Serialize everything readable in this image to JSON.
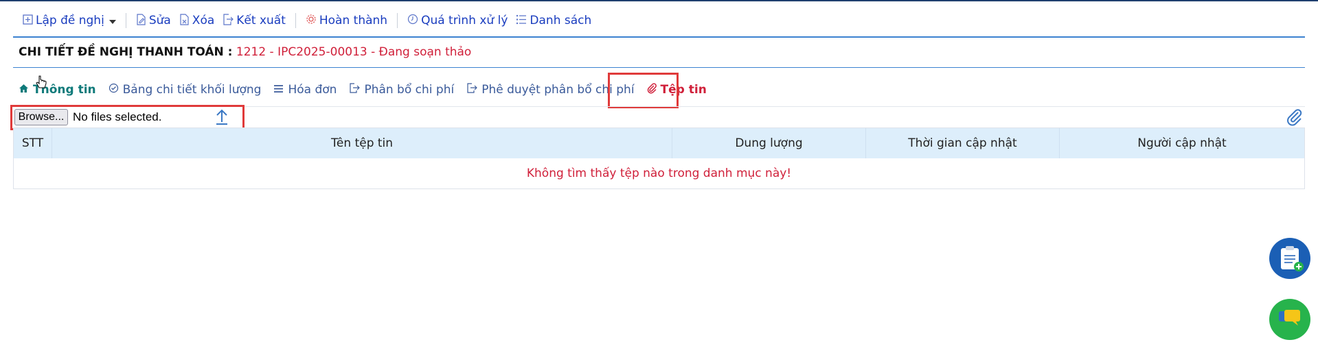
{
  "toolbar": {
    "create": "Lập đề nghị",
    "edit": "Sửa",
    "delete": "Xóa",
    "export": "Kết xuất",
    "complete": "Hoàn thành",
    "process": "Quá trình xử lý",
    "list": "Danh sách"
  },
  "header": {
    "label": "CHI TIẾT ĐỀ NGHỊ THANH TOÁN :",
    "value": "1212 - IPC2025-00013 - Đang soạn thảo"
  },
  "tabs": [
    {
      "label": "Thông tin"
    },
    {
      "label": "Bảng chi tiết khối lượng"
    },
    {
      "label": "Hóa đơn"
    },
    {
      "label": "Phân bổ chi phí"
    },
    {
      "label": "Phê duyệt phân bổ chi phí"
    },
    {
      "label": "Tệp tin"
    }
  ],
  "upload": {
    "browse_label": "Browse...",
    "status": "No files selected."
  },
  "table": {
    "columns": [
      "STT",
      "Tên tệp tin",
      "Dung lượng",
      "Thời gian cập nhật",
      "Người cập nhật"
    ],
    "empty_message": "Không tìm thấy tệp nào trong danh mục này!"
  },
  "colors": {
    "accent_blue": "#1a3dbf",
    "status_red": "#d0203a",
    "header_bg": "#ddeefb",
    "highlight_red": "#e03a3a"
  }
}
